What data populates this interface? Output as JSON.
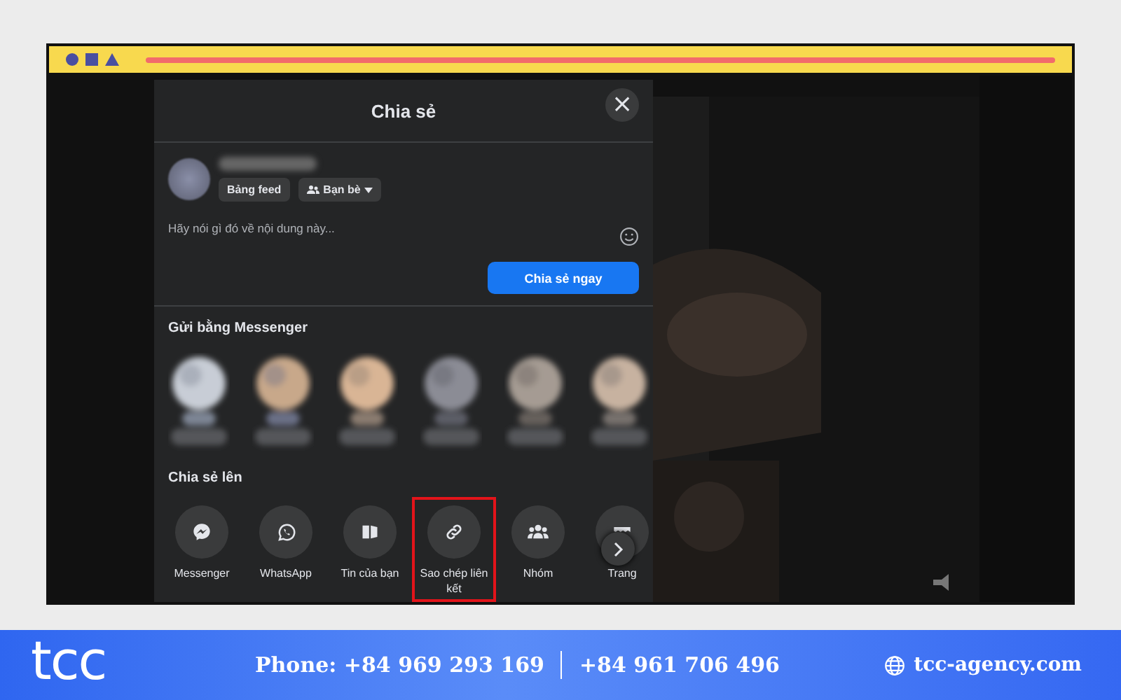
{
  "browser_bar": {
    "shapes": [
      {
        "kind": "circle"
      },
      {
        "kind": "square"
      },
      {
        "kind": "triangle"
      }
    ]
  },
  "dialog": {
    "title": "Chia sẻ",
    "close": "×",
    "composer": {
      "audience_chips": [
        {
          "label": "Bảng feed",
          "kind": "plain"
        },
        {
          "label": "Bạn bè",
          "kind": "friends"
        }
      ],
      "placeholder": "Hãy nói gì đó về nội dung này...",
      "submit": "Chia sẻ ngay"
    },
    "messenger_section": {
      "heading": "Gửi bằng Messenger"
    },
    "share_section": {
      "heading": "Chia sẻ lên",
      "targets": [
        {
          "label": "Messenger",
          "kind": "messenger",
          "highlighted": false
        },
        {
          "label": "WhatsApp",
          "kind": "whatsapp",
          "highlighted": false
        },
        {
          "label": "Tin của bạn",
          "kind": "story",
          "highlighted": false
        },
        {
          "label": "Sao chép liên kết",
          "kind": "link",
          "highlighted": true
        },
        {
          "label": "Nhóm",
          "kind": "group",
          "highlighted": false
        },
        {
          "label": "Trang",
          "kind": "page",
          "highlighted": false
        }
      ]
    }
  },
  "banner": {
    "logo": "tcc",
    "phone_1": "Phone: +84 969 293 169",
    "phone_2": "+84 961 706 496",
    "website": "tcc-agency.com"
  }
}
